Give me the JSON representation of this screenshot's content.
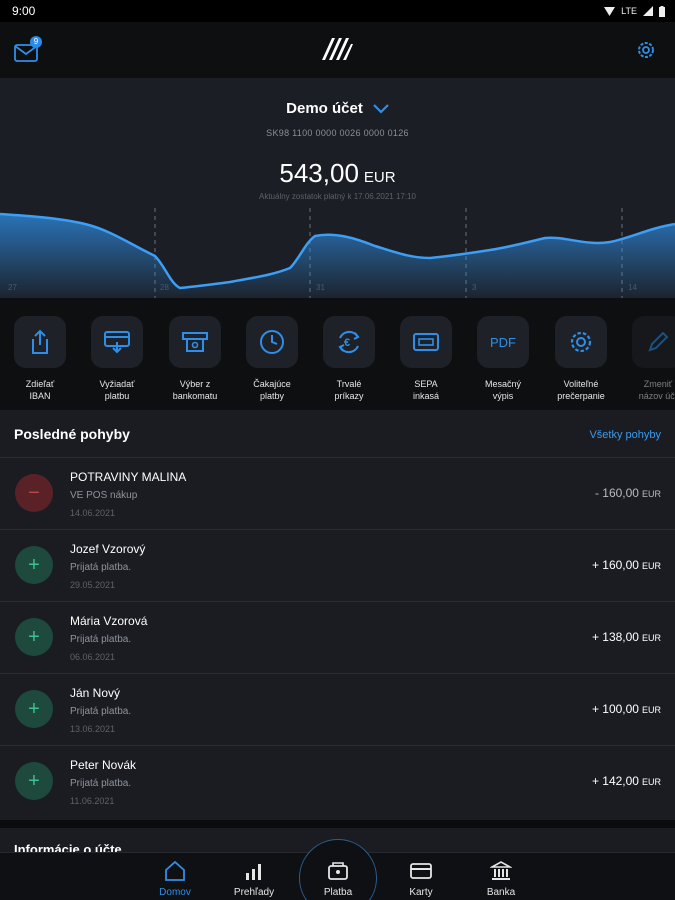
{
  "status_bar": {
    "time": "9:00",
    "network": "LTE"
  },
  "header": {
    "unread_count": "9"
  },
  "account": {
    "name": "Demo účet",
    "iban": "SK98 1100 0000 0026 0000 0126",
    "balance": "543,00",
    "currency": "EUR",
    "balance_note": "Aktuálny zostatok platný k 17.06.2021 17:10",
    "chart_ticks": [
      "27",
      "28",
      "31",
      "3",
      "14"
    ]
  },
  "quick_actions": [
    {
      "label": "Zdieľať\nIBAN",
      "icon": "share-icon"
    },
    {
      "label": "Vyžiadať\nplatbu",
      "icon": "request-payment-icon"
    },
    {
      "label": "Výber z\nbankomatu",
      "icon": "atm-withdrawal-icon"
    },
    {
      "label": "Čakajúce\nplatby",
      "icon": "clock-icon"
    },
    {
      "label": "Trvalé\npríkazy",
      "icon": "standing-order-icon"
    },
    {
      "label": "SEPA\ninkasá",
      "icon": "sepa-card-icon"
    },
    {
      "label": "Mesačný\nvýpis",
      "icon": "pdf-statement-icon",
      "glyph": "PDF"
    },
    {
      "label": "Voliteľné\nprečerpanie",
      "icon": "gear-icon"
    },
    {
      "label": "Zmeniť\nnázov úč.",
      "icon": "pencil-icon"
    }
  ],
  "transactions": {
    "title": "Posledné pohyby",
    "all_link": "Všetky pohyby",
    "items": [
      {
        "name": "POTRAVINY MALINA",
        "description": "VE POS nákup",
        "date": "14.06.2021",
        "amount": "- 160,00",
        "currency": "EUR",
        "type": "debit",
        "sign": "−"
      },
      {
        "name": "Jozef Vzorový",
        "description": "Prijatá platba.",
        "date": "29.05.2021",
        "amount": "+ 160,00",
        "currency": "EUR",
        "type": "credit",
        "sign": "+"
      },
      {
        "name": "Mária Vzorová",
        "description": "Prijatá platba.",
        "date": "06.06.2021",
        "amount": "+ 138,00",
        "currency": "EUR",
        "type": "credit",
        "sign": "+"
      },
      {
        "name": "Ján Nový",
        "description": "Prijatá platba.",
        "date": "13.06.2021",
        "amount": "+ 100,00",
        "currency": "EUR",
        "type": "credit",
        "sign": "+"
      },
      {
        "name": "Peter Novák",
        "description": "Prijatá platba.",
        "date": "11.06.2021",
        "amount": "+ 142,00",
        "currency": "EUR",
        "type": "credit",
        "sign": "+"
      }
    ]
  },
  "account_info": {
    "title": "Informácie o účte"
  },
  "bottom_nav": [
    {
      "label": "Domov",
      "icon": "home-icon",
      "active": true
    },
    {
      "label": "Prehľady",
      "icon": "bar-chart-icon"
    },
    {
      "label": "Platba",
      "icon": "wallet-icon"
    },
    {
      "label": "Karty",
      "icon": "card-icon"
    },
    {
      "label": "Banka",
      "icon": "bank-icon"
    }
  ],
  "colors": {
    "accent": "#2f8fe8",
    "background": "#1a1c21",
    "credit": "#3fbf8f",
    "debit": "#b84850"
  }
}
